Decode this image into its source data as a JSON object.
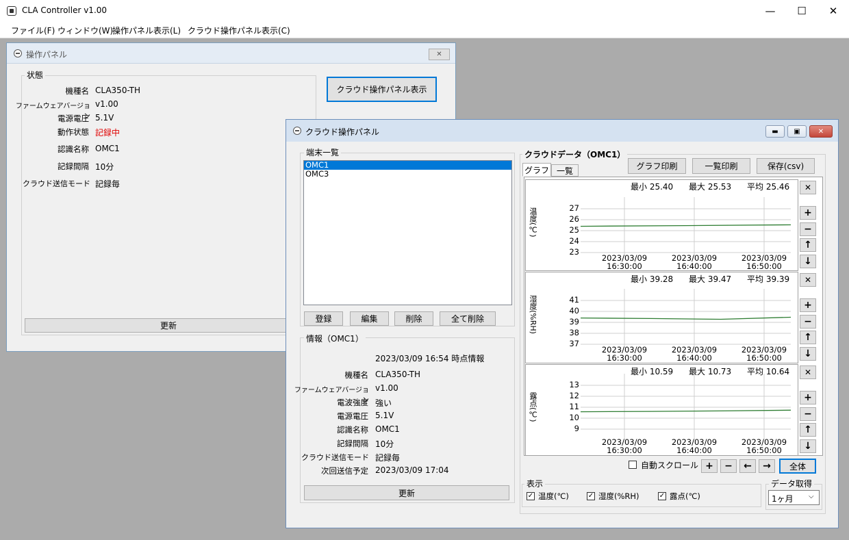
{
  "app": {
    "title": "CLA Controller v1.00",
    "menu": [
      "ファイル(F)",
      "ウィンドウ(W)",
      "操作パネル表示(L)",
      "クラウド操作パネル表示(C)"
    ],
    "controls": {
      "minimize": "—",
      "maximize": "☐",
      "close": "✕"
    }
  },
  "panel1": {
    "title": "操作パネル",
    "close": "✕",
    "status_group": "状態",
    "cloud_button": "クラウド操作パネル表示",
    "update_button": "更新",
    "fields": [
      {
        "label": "機種名",
        "value": "CLA350-TH"
      },
      {
        "label": "ファームウェアバージョン",
        "value": "v1.00"
      },
      {
        "label": "電源電圧",
        "value": "5.1V"
      },
      {
        "label": "動作状態",
        "value": "記録中"
      },
      {
        "label": "認識名称",
        "value": "OMC1"
      },
      {
        "label": "記録間隔",
        "value": "10分"
      },
      {
        "label": "クラウド送信モード",
        "value": "記録毎"
      }
    ]
  },
  "panel2": {
    "title": "クラウド操作パネル",
    "controls": {
      "minimize": "▬",
      "restore": "▣",
      "close": "✕"
    },
    "terminal_group": "端末一覧",
    "terminals": [
      "OMC1",
      "OMC3"
    ],
    "selected_terminal": "OMC1",
    "terminal_buttons": {
      "register": "登録",
      "edit": "編集",
      "delete": "削除",
      "delete_all": "全て削除"
    },
    "info_group": "情報（OMC1）",
    "info_timestamp": "2023/03/09 16:54 時点情報",
    "info": [
      {
        "label": "機種名",
        "value": "CLA350-TH"
      },
      {
        "label": "ファームウェアバージョン",
        "value": "v1.00"
      },
      {
        "label": "電波強度",
        "value": "強い"
      },
      {
        "label": "電源電圧",
        "value": "5.1V"
      },
      {
        "label": "認識名称",
        "value": "OMC1"
      },
      {
        "label": "記録間隔",
        "value": "10分"
      },
      {
        "label": "クラウド送信モード",
        "value": "記録毎"
      },
      {
        "label": "次回送信予定",
        "value": "2023/03/09 17:04"
      }
    ],
    "update_button": "更新",
    "cloud_group": "クラウドデータ（OMC1）",
    "tabs": [
      "グラフ",
      "一覧"
    ],
    "actions": {
      "graph_print": "グラフ印刷",
      "list_print": "一覧印刷",
      "save": "保存(csv)"
    },
    "auto_scroll": "自動スクロール",
    "nav": {
      "plus": "+",
      "minus": "−",
      "left": "←",
      "right": "→",
      "all": "全体"
    },
    "graph_buttons": {
      "close": "✕",
      "zoom_in": "+",
      "zoom_out": "−",
      "up": "↑",
      "down": "↓"
    },
    "display_group": "表示",
    "display_options": [
      {
        "label": "温度(℃)",
        "checked": true
      },
      {
        "label": "湿度(%RH)",
        "checked": true
      },
      {
        "label": "露点(℃)",
        "checked": true
      }
    ],
    "fetch_group": "データ取得",
    "fetch_value": "1ヶ月"
  },
  "chart_data": [
    {
      "type": "line",
      "ylabel": "温度(℃)",
      "ylim": [
        23,
        27
      ],
      "yticks": [
        "27",
        "26",
        "25",
        "24",
        "23"
      ],
      "stats": {
        "min": "最小 25.40",
        "max": "最大 25.53",
        "avg": "平均 25.46"
      },
      "x": [
        "2023/03/09 16:30:00",
        "2023/03/09 16:40:00",
        "2023/03/09 16:50:00"
      ],
      "series": [
        {
          "values": [
            25.4,
            25.46,
            25.53
          ]
        }
      ],
      "color": "#2e7d32"
    },
    {
      "type": "line",
      "ylabel": "湿度(%RH)",
      "ylim": [
        37,
        41
      ],
      "yticks": [
        "41",
        "40",
        "39",
        "38",
        "37"
      ],
      "stats": {
        "min": "最小 39.28",
        "max": "最大 39.47",
        "avg": "平均 39.39"
      },
      "x": [
        "2023/03/09 16:30:00",
        "2023/03/09 16:40:00",
        "2023/03/09 16:50:00"
      ],
      "series": [
        {
          "values": [
            39.4,
            39.35,
            39.28,
            39.47
          ]
        }
      ],
      "color": "#2e7d32"
    },
    {
      "type": "line",
      "ylabel": "露点(℃)",
      "ylim": [
        9,
        13
      ],
      "yticks": [
        "13",
        "12",
        "11",
        "10",
        "9"
      ],
      "stats": {
        "min": "最小 10.59",
        "max": "最大 10.73",
        "avg": "平均 10.64"
      },
      "x": [
        "2023/03/09 16:30:00",
        "2023/03/09 16:40:00",
        "2023/03/09 16:50:00"
      ],
      "series": [
        {
          "values": [
            10.59,
            10.62,
            10.66,
            10.73
          ]
        }
      ],
      "color": "#2e7d32"
    }
  ]
}
